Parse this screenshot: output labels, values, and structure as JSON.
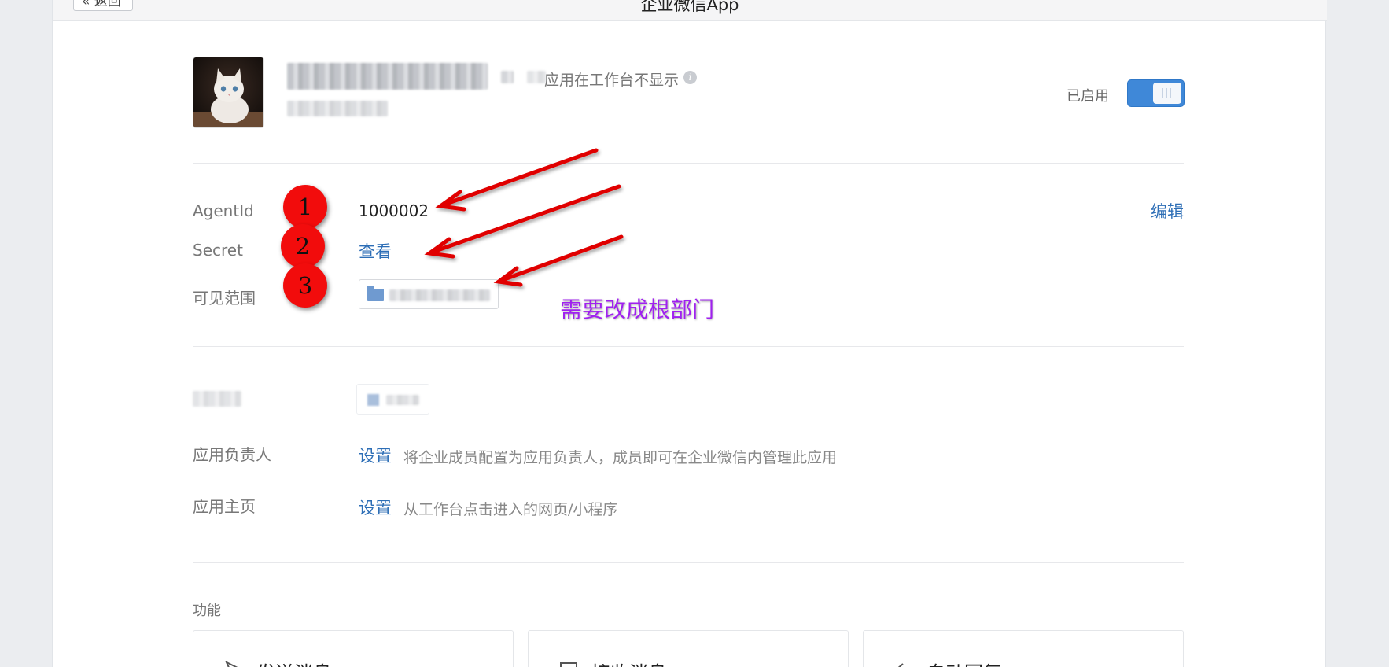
{
  "topbar": {
    "back_label": "« 返回",
    "title": "企业微信App"
  },
  "app": {
    "workspace_hidden_note": "应用在工作台不显示",
    "enabled_label": "已启用",
    "enabled": true
  },
  "details": {
    "agentid_label": "AgentId",
    "agentid_value": "1000002",
    "edit_label": "编辑",
    "secret_label": "Secret",
    "secret_view": "查看",
    "scope_label": "可见范围"
  },
  "annotations": {
    "badges": [
      "1",
      "2",
      "3"
    ],
    "note": "需要改成根部门",
    "color_note": "#a020f0",
    "color_badge": "#f20c0c",
    "color_arrow": "#e00000"
  },
  "settings": {
    "owner_label": "应用负责人",
    "owner_action": "设置",
    "owner_hint": "将企业成员配置为应用负责人，成员即可在企业微信内管理此应用",
    "homepage_label": "应用主页",
    "homepage_action": "设置",
    "homepage_hint": "从工作台点击进入的网页/小程序"
  },
  "features": {
    "title": "功能",
    "cards": [
      {
        "label": "发送消息",
        "icon": "send-icon"
      },
      {
        "label": "接收消息",
        "icon": "message-icon"
      },
      {
        "label": "自动回复",
        "icon": "reply-icon"
      }
    ]
  },
  "colors": {
    "link": "#2d6eb6",
    "toggle": "#3f88d8"
  }
}
